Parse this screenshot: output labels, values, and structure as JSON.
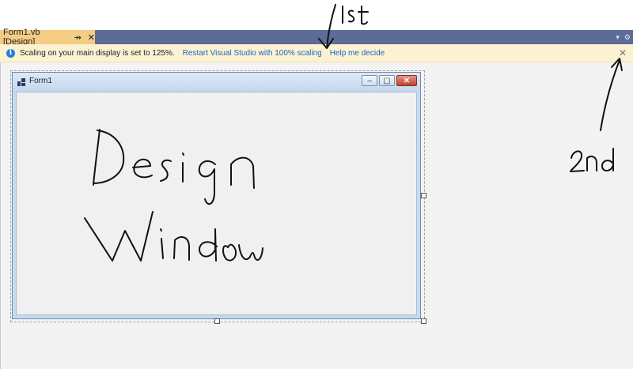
{
  "tab": {
    "title": "Form1.vb [Design]",
    "pin_glyph": "⇸",
    "close_glyph": "✕"
  },
  "strip_controls": {
    "dropdown_glyph": "▾",
    "settings_glyph": "⚙"
  },
  "infobar": {
    "message": "Scaling on your main display is set to 125%.",
    "link_restart": "Restart Visual Studio with 100% scaling",
    "link_help": "Help me decide",
    "close_glyph": "✕"
  },
  "form": {
    "title": "Form1",
    "minimize_glyph": "–",
    "maximize_glyph": "▢",
    "close_glyph": "✕"
  },
  "colors": {
    "tab_strip": "#5d6b99",
    "active_tab": "#f5cc84",
    "infobar": "#fcf2d2",
    "link": "#1a64c4"
  },
  "annotations": {
    "handwritten": [
      "1st",
      "2nd",
      "Design Window"
    ]
  }
}
